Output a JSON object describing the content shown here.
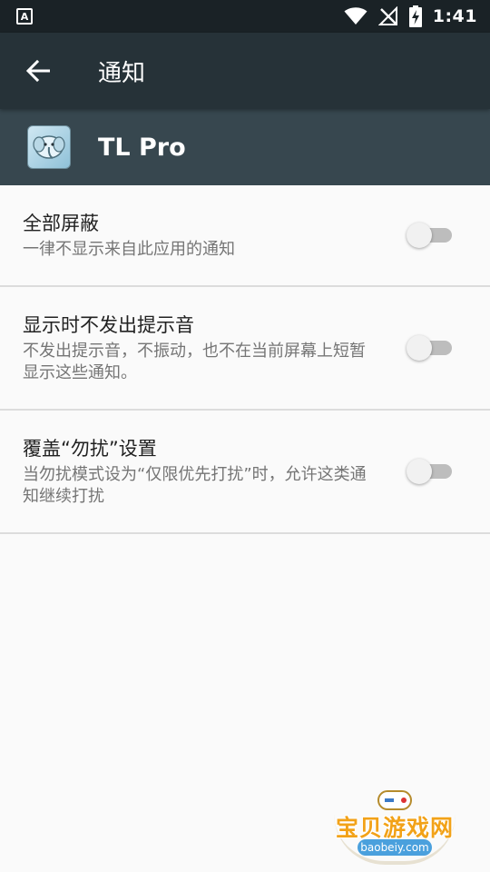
{
  "status_bar": {
    "notification_glyph": "A",
    "time": "1:41",
    "icons": [
      "wifi-icon",
      "no-signal-icon",
      "battery-charging-icon"
    ]
  },
  "app_bar": {
    "title": "通知",
    "back_icon": "arrow-left-icon"
  },
  "app_header": {
    "app_name": "TL Pro"
  },
  "settings": [
    {
      "title": "全部屏蔽",
      "summary": "一律不显示来自此应用的通知",
      "enabled": false
    },
    {
      "title": "显示时不发出提示音",
      "summary": "不发出提示音，不振动，也不在当前屏幕上短暂显示这些通知。",
      "enabled": false
    },
    {
      "title": "覆盖“勿扰”设置",
      "summary": "当勿扰模式设为“仅限优先打扰”时，允许这类通知继续打扰",
      "enabled": false
    }
  ],
  "watermark": {
    "brand": "宝贝游戏网",
    "domain": "baobeiy.com"
  },
  "colors": {
    "status_bar": "#1a2226",
    "app_bar": "#263238",
    "app_header": "#37474f",
    "background": "#fafafa",
    "toggle_track_off": "#bdbdbd",
    "toggle_thumb_off": "#f1f1f1"
  }
}
